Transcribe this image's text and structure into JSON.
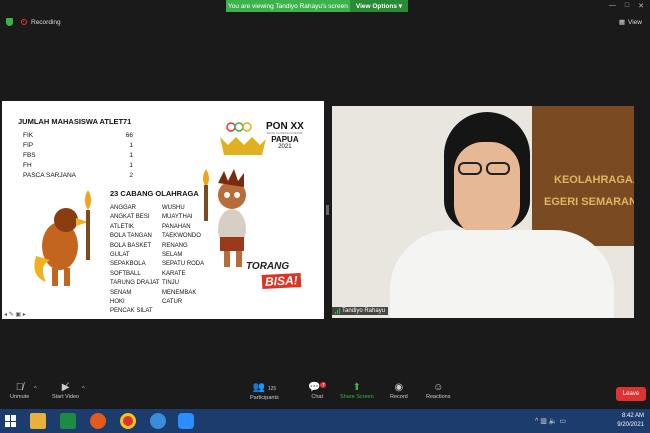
{
  "banner": {
    "message": "You are viewing Tandiyo Rahayu's screen",
    "view_options": "View Options ▾"
  },
  "status": {
    "recording": "Recording",
    "view": "View"
  },
  "slide": {
    "title": "JUMLAH MAHASISWA ATLET",
    "total": "71",
    "faculties": [
      {
        "name": "FIK",
        "count": "66"
      },
      {
        "name": "FIP",
        "count": "1"
      },
      {
        "name": "FBS",
        "count": "1"
      },
      {
        "name": "FH",
        "count": "1"
      },
      {
        "name": "PASCA SARJANA",
        "count": "2"
      }
    ],
    "sports_heading": "23 CABANG OLAHRAGA",
    "sports_left": [
      "ANGGAR",
      "ANGKAT BESI",
      "ATLETIK",
      "BOLA TANGAN",
      "BOLA BASKET",
      "GULAT",
      "SEPAKBOLA",
      "SOFTBALL",
      "TARUNG DRAJAT",
      "SENAM",
      "HOKI",
      "PENCAK SILAT"
    ],
    "sports_right": [
      "WUSHU",
      "MUAYTHAI",
      "PANAHAN",
      "TAEKWONDO",
      "RENANG",
      "SELAM",
      "SEPATU RODA",
      "KARATE",
      "TINJU",
      "MENEMBAK",
      "CATUR"
    ],
    "pon_title": "PON XX",
    "pon_small": "PEKAN OLAHRAGA NASIONAL",
    "pon_place": "PAPUA",
    "pon_year": "2021",
    "torang": "TORANG",
    "bisa": "BISA!"
  },
  "video": {
    "name": "Tandiyo Rahayu",
    "sign_line1": "KEOLAHRAGAAN",
    "sign_line2": "EGERI SEMARANG"
  },
  "toolbar": {
    "unmute": "Unmute",
    "start_video": "Start Video",
    "participants": "Participants",
    "participants_count": "125",
    "chat": "Chat",
    "chat_badge": "7",
    "share_screen": "Share Screen",
    "record": "Record",
    "reactions": "Reactions",
    "leave": "Leave"
  },
  "taskbar": {
    "time": "8:42 AM",
    "date": "9/20/2021"
  },
  "colors": {
    "accent_green": "#3bb34a",
    "leave_red": "#dd3333",
    "taskbar": "#1c3c6e"
  }
}
